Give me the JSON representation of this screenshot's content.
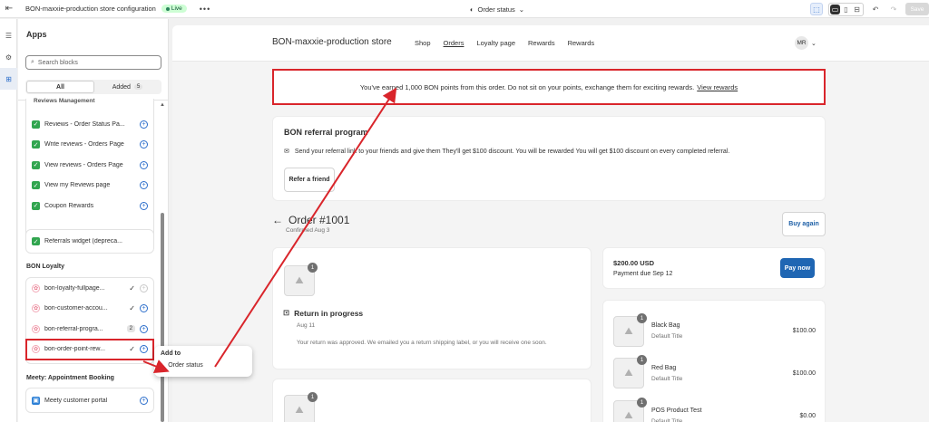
{
  "topbar": {
    "store_config_title": "BON-maxxie-production store configuration",
    "live_badge": "Live",
    "more": "•••",
    "page_selector": "Order status",
    "save_label": "Save"
  },
  "panel": {
    "title": "Apps",
    "search_placeholder": "Search blocks",
    "tabs": [
      {
        "label": "All"
      },
      {
        "label": "Added",
        "count": "5"
      }
    ],
    "reviews_group": {
      "header": "Reviews Management",
      "items": [
        {
          "label": "Reviews - Order Status Pa..."
        },
        {
          "label": "Write reviews - Orders Page"
        },
        {
          "label": "View reviews - Orders Page"
        },
        {
          "label": "View my Reviews page"
        },
        {
          "label": "Coupon Rewards"
        }
      ]
    },
    "referrals_widget": {
      "label": "Referrals widget (depreca..."
    },
    "bon_loyalty": {
      "header": "BON Loyalty",
      "items": [
        {
          "label": "bon-loyalty-fullpage..."
        },
        {
          "label": "bon-customer-accou..."
        },
        {
          "label": "bon-referral-progra...",
          "count": "2"
        },
        {
          "label": "bon-order-point-rew..."
        }
      ]
    },
    "meety": {
      "header": "Meety: Appointment Booking",
      "items": [
        {
          "label": "Meety customer portal"
        }
      ]
    }
  },
  "popover": {
    "title": "Add to",
    "item": "Order status"
  },
  "store": {
    "name": "BON-maxxie-production store",
    "nav": [
      "Shop",
      "Orders",
      "Loyalty page",
      "Rewards",
      "Rewards"
    ],
    "avatar": "MR"
  },
  "banner": {
    "text": "You've earned 1,000 BON points from this order. Do not sit on your points, exchange them for exciting rewards.",
    "link": "View rewards"
  },
  "referral": {
    "title": "BON referral program",
    "desc": "Send your referral link to your friends and give them They'll get $100 discount. You will be rewarded You will get $100 discount on every completed referral.",
    "button": "Refer a friend"
  },
  "order": {
    "title": "Order #1001",
    "confirmed": "Confirmed Aug 3",
    "buy_again": "Buy again",
    "return_qty": "1",
    "return_title": "Return in progress",
    "return_date": "Aug 11",
    "return_msg": "Your return was approved. We emailed you a return shipping label, or you will receive one soon.",
    "second_qty": "1"
  },
  "payment": {
    "amount": "$200.00 USD",
    "due": "Payment due Sep 12",
    "pay_now": "Pay now"
  },
  "line_items": [
    {
      "name": "Black Bag",
      "variant": "Default Title",
      "price": "$100.00",
      "qty": "1"
    },
    {
      "name": "Red Bag",
      "variant": "Default Title",
      "price": "$100.00",
      "qty": "1"
    },
    {
      "name": "POS Product Test",
      "variant": "Default Title",
      "price": "$0.00",
      "qty": "1"
    }
  ],
  "colors": {
    "annotation_red": "#d9252b",
    "accent_blue": "#2c6ecb",
    "pay_button": "#1f66b3",
    "live_green": "#29845a"
  }
}
